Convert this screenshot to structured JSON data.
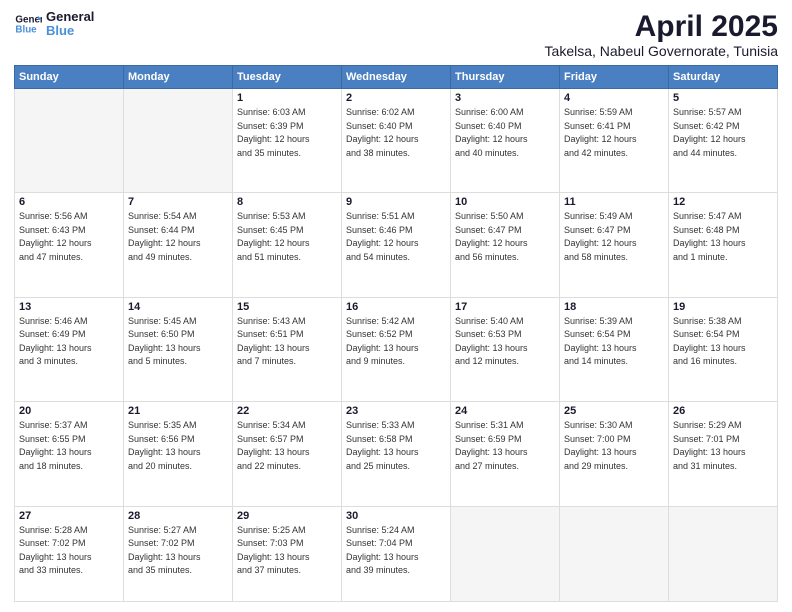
{
  "logo": {
    "line1": "General",
    "line2": "Blue"
  },
  "title": "April 2025",
  "location": "Takelsa, Nabeul Governorate, Tunisia",
  "weekdays": [
    "Sunday",
    "Monday",
    "Tuesday",
    "Wednesday",
    "Thursday",
    "Friday",
    "Saturday"
  ],
  "weeks": [
    [
      {
        "day": "",
        "detail": ""
      },
      {
        "day": "",
        "detail": ""
      },
      {
        "day": "1",
        "detail": "Sunrise: 6:03 AM\nSunset: 6:39 PM\nDaylight: 12 hours\nand 35 minutes."
      },
      {
        "day": "2",
        "detail": "Sunrise: 6:02 AM\nSunset: 6:40 PM\nDaylight: 12 hours\nand 38 minutes."
      },
      {
        "day": "3",
        "detail": "Sunrise: 6:00 AM\nSunset: 6:40 PM\nDaylight: 12 hours\nand 40 minutes."
      },
      {
        "day": "4",
        "detail": "Sunrise: 5:59 AM\nSunset: 6:41 PM\nDaylight: 12 hours\nand 42 minutes."
      },
      {
        "day": "5",
        "detail": "Sunrise: 5:57 AM\nSunset: 6:42 PM\nDaylight: 12 hours\nand 44 minutes."
      }
    ],
    [
      {
        "day": "6",
        "detail": "Sunrise: 5:56 AM\nSunset: 6:43 PM\nDaylight: 12 hours\nand 47 minutes."
      },
      {
        "day": "7",
        "detail": "Sunrise: 5:54 AM\nSunset: 6:44 PM\nDaylight: 12 hours\nand 49 minutes."
      },
      {
        "day": "8",
        "detail": "Sunrise: 5:53 AM\nSunset: 6:45 PM\nDaylight: 12 hours\nand 51 minutes."
      },
      {
        "day": "9",
        "detail": "Sunrise: 5:51 AM\nSunset: 6:46 PM\nDaylight: 12 hours\nand 54 minutes."
      },
      {
        "day": "10",
        "detail": "Sunrise: 5:50 AM\nSunset: 6:47 PM\nDaylight: 12 hours\nand 56 minutes."
      },
      {
        "day": "11",
        "detail": "Sunrise: 5:49 AM\nSunset: 6:47 PM\nDaylight: 12 hours\nand 58 minutes."
      },
      {
        "day": "12",
        "detail": "Sunrise: 5:47 AM\nSunset: 6:48 PM\nDaylight: 13 hours\nand 1 minute."
      }
    ],
    [
      {
        "day": "13",
        "detail": "Sunrise: 5:46 AM\nSunset: 6:49 PM\nDaylight: 13 hours\nand 3 minutes."
      },
      {
        "day": "14",
        "detail": "Sunrise: 5:45 AM\nSunset: 6:50 PM\nDaylight: 13 hours\nand 5 minutes."
      },
      {
        "day": "15",
        "detail": "Sunrise: 5:43 AM\nSunset: 6:51 PM\nDaylight: 13 hours\nand 7 minutes."
      },
      {
        "day": "16",
        "detail": "Sunrise: 5:42 AM\nSunset: 6:52 PM\nDaylight: 13 hours\nand 9 minutes."
      },
      {
        "day": "17",
        "detail": "Sunrise: 5:40 AM\nSunset: 6:53 PM\nDaylight: 13 hours\nand 12 minutes."
      },
      {
        "day": "18",
        "detail": "Sunrise: 5:39 AM\nSunset: 6:54 PM\nDaylight: 13 hours\nand 14 minutes."
      },
      {
        "day": "19",
        "detail": "Sunrise: 5:38 AM\nSunset: 6:54 PM\nDaylight: 13 hours\nand 16 minutes."
      }
    ],
    [
      {
        "day": "20",
        "detail": "Sunrise: 5:37 AM\nSunset: 6:55 PM\nDaylight: 13 hours\nand 18 minutes."
      },
      {
        "day": "21",
        "detail": "Sunrise: 5:35 AM\nSunset: 6:56 PM\nDaylight: 13 hours\nand 20 minutes."
      },
      {
        "day": "22",
        "detail": "Sunrise: 5:34 AM\nSunset: 6:57 PM\nDaylight: 13 hours\nand 22 minutes."
      },
      {
        "day": "23",
        "detail": "Sunrise: 5:33 AM\nSunset: 6:58 PM\nDaylight: 13 hours\nand 25 minutes."
      },
      {
        "day": "24",
        "detail": "Sunrise: 5:31 AM\nSunset: 6:59 PM\nDaylight: 13 hours\nand 27 minutes."
      },
      {
        "day": "25",
        "detail": "Sunrise: 5:30 AM\nSunset: 7:00 PM\nDaylight: 13 hours\nand 29 minutes."
      },
      {
        "day": "26",
        "detail": "Sunrise: 5:29 AM\nSunset: 7:01 PM\nDaylight: 13 hours\nand 31 minutes."
      }
    ],
    [
      {
        "day": "27",
        "detail": "Sunrise: 5:28 AM\nSunset: 7:02 PM\nDaylight: 13 hours\nand 33 minutes."
      },
      {
        "day": "28",
        "detail": "Sunrise: 5:27 AM\nSunset: 7:02 PM\nDaylight: 13 hours\nand 35 minutes."
      },
      {
        "day": "29",
        "detail": "Sunrise: 5:25 AM\nSunset: 7:03 PM\nDaylight: 13 hours\nand 37 minutes."
      },
      {
        "day": "30",
        "detail": "Sunrise: 5:24 AM\nSunset: 7:04 PM\nDaylight: 13 hours\nand 39 minutes."
      },
      {
        "day": "",
        "detail": ""
      },
      {
        "day": "",
        "detail": ""
      },
      {
        "day": "",
        "detail": ""
      }
    ]
  ]
}
